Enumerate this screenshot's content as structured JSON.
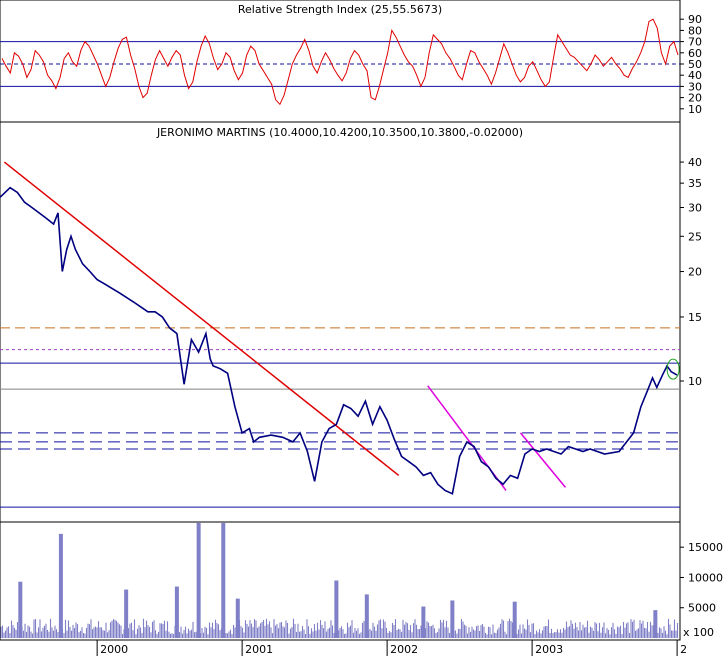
{
  "colors": {
    "price": "#000080",
    "rsi": "#e00000",
    "trend_red": "#e00000",
    "trend_magenta": "#e000e0",
    "volume": "#8080c8",
    "orange_level": "#c87020",
    "blue_level": "#1010a0",
    "violet_level": "#a040c0",
    "grid": "#000000"
  },
  "chart_data": [
    {
      "id": "rsi",
      "type": "line",
      "title": "Relative Strength Index (25,55.5673)",
      "ylim": [
        0,
        100
      ],
      "yticks": [
        10,
        20,
        30,
        40,
        50,
        60,
        70,
        80,
        90
      ],
      "levels": [
        70,
        50,
        30
      ],
      "x_start": 1999.33,
      "x_end": 2004.02,
      "series": [
        {
          "values": [
            55,
            48,
            42,
            60,
            57,
            50,
            38,
            45,
            62,
            58,
            52,
            40,
            35,
            28,
            38,
            55,
            60,
            52,
            48,
            62,
            70,
            66,
            58,
            50,
            40,
            30,
            38,
            52,
            64,
            72,
            74,
            58,
            46,
            30,
            20,
            24,
            40,
            54,
            62,
            55,
            48,
            56,
            62,
            58,
            40,
            28,
            34,
            52,
            66,
            75,
            68,
            55,
            45,
            50,
            60,
            56,
            44,
            36,
            42,
            58,
            66,
            62,
            50,
            44,
            38,
            32,
            18,
            14,
            22,
            36,
            50,
            58,
            64,
            72,
            62,
            48,
            42,
            52,
            60,
            54,
            46,
            40,
            35,
            42,
            55,
            62,
            58,
            50,
            44,
            20,
            18,
            30,
            45,
            60,
            80,
            74,
            66,
            58,
            52,
            48,
            40,
            30,
            38,
            60,
            76,
            72,
            68,
            60,
            55,
            48,
            40,
            36,
            50,
            62,
            60,
            52,
            46,
            40,
            32,
            42,
            55,
            68,
            60,
            50,
            40,
            34,
            38,
            48,
            52,
            44,
            36,
            30,
            34,
            56,
            76,
            70,
            64,
            58,
            56,
            52,
            48,
            44,
            50,
            58,
            54,
            48,
            52,
            56,
            50,
            46,
            40,
            38,
            46,
            52,
            60,
            70,
            88,
            90,
            82,
            60,
            50,
            66,
            70,
            58
          ]
        }
      ]
    },
    {
      "id": "price",
      "type": "line",
      "title": "JERONIMO MARTINS (10.4000,10.4200,10.3500,10.3800,-0.02000)",
      "scale": "log",
      "ylim": [
        4.2,
        46
      ],
      "yticks": [
        10,
        15,
        20,
        25,
        30,
        35,
        40
      ],
      "x_start": 1999.33,
      "x_end": 2004.02,
      "xticks": [
        "2000",
        "2001",
        "2002",
        "2003",
        "2"
      ],
      "xtick_positions": [
        2000,
        2001,
        2002,
        2003,
        2004
      ],
      "series": [
        {
          "x": [
            1999.33,
            1999.4,
            1999.45,
            1999.5,
            1999.55,
            1999.6,
            1999.65,
            1999.7,
            1999.73,
            1999.76,
            1999.79,
            1999.82,
            1999.85,
            1999.9,
            1999.95,
            2000.0,
            2000.05,
            2000.1,
            2000.15,
            2000.2,
            2000.25,
            2000.3,
            2000.35,
            2000.4,
            2000.45,
            2000.5,
            2000.55,
            2000.6,
            2000.65,
            2000.7,
            2000.75,
            2000.78,
            2000.8,
            2000.85,
            2000.9,
            2000.95,
            2001.0,
            2001.05,
            2001.08,
            2001.12,
            2001.2,
            2001.28,
            2001.35,
            2001.4,
            2001.45,
            2001.5,
            2001.55,
            2001.6,
            2001.65,
            2001.7,
            2001.75,
            2001.8,
            2001.85,
            2001.9,
            2001.95,
            2002.0,
            2002.05,
            2002.1,
            2002.15,
            2002.2,
            2002.25,
            2002.3,
            2002.35,
            2002.4,
            2002.45,
            2002.5,
            2002.55,
            2002.6,
            2002.65,
            2002.7,
            2002.75,
            2002.8,
            2002.85,
            2002.9,
            2002.95,
            2003.0,
            2003.05,
            2003.1,
            2003.15,
            2003.2,
            2003.25,
            2003.3,
            2003.35,
            2003.4,
            2003.5,
            2003.6,
            2003.7,
            2003.75,
            2003.8,
            2003.83,
            2003.86,
            2003.9,
            2003.93,
            2003.96,
            2004.0
          ],
          "y": [
            32,
            34,
            33,
            31,
            30,
            29,
            28,
            27,
            29,
            20,
            23,
            25,
            23,
            21,
            20,
            19,
            18.5,
            18,
            17.5,
            17,
            16.5,
            16,
            15.5,
            15.5,
            15,
            14,
            13.5,
            9.8,
            13,
            12,
            13.5,
            11.5,
            11,
            10.8,
            10.5,
            8.5,
            7.2,
            7.4,
            6.8,
            7.0,
            7.1,
            7.0,
            6.8,
            7.2,
            6.4,
            5.3,
            6.8,
            7.4,
            7.6,
            8.6,
            8.4,
            8.0,
            8.8,
            7.6,
            8.5,
            7.8,
            6.9,
            6.2,
            6.0,
            5.8,
            5.5,
            5.6,
            5.2,
            5.0,
            4.9,
            6.2,
            6.8,
            6.6,
            6.0,
            5.8,
            5.4,
            5.2,
            5.5,
            5.4,
            6.3,
            6.5,
            6.4,
            6.5,
            6.4,
            6.3,
            6.6,
            6.5,
            6.4,
            6.5,
            6.3,
            6.4,
            7.2,
            8.5,
            9.5,
            10.2,
            9.6,
            10.4,
            11.0,
            10.6,
            10.38
          ]
        }
      ],
      "horizontal_levels": [
        {
          "value": 14.0,
          "style": "orange-dashed"
        },
        {
          "value": 12.2,
          "style": "violet-dashed"
        },
        {
          "value": 11.2,
          "style": "blue-solid"
        },
        {
          "value": 9.5,
          "style": "grey-solid"
        },
        {
          "value": 7.2,
          "style": "blue-dashed"
        },
        {
          "value": 6.8,
          "style": "blue-dashed"
        },
        {
          "value": 6.5,
          "style": "blue-dashed"
        },
        {
          "value": 4.5,
          "style": "blue-solid"
        }
      ],
      "trendlines": [
        {
          "color": "red",
          "from": [
            1999.36,
            40
          ],
          "to": [
            2002.08,
            5.5
          ]
        },
        {
          "color": "magenta",
          "from": [
            2002.28,
            9.7
          ],
          "to": [
            2002.82,
            5.0
          ]
        },
        {
          "color": "magenta",
          "from": [
            2002.92,
            7.2
          ],
          "to": [
            2003.23,
            5.1
          ]
        }
      ]
    },
    {
      "id": "volume",
      "type": "bar",
      "ylim": [
        0,
        18500
      ],
      "yticks": [
        5000,
        10000,
        15000
      ],
      "x_unit_label": "x 100",
      "x_start": 1999.33,
      "x_end": 2004.02,
      "spikes": [
        {
          "x": 1999.47,
          "value": 9300
        },
        {
          "x": 1999.75,
          "value": 17200
        },
        {
          "x": 2000.2,
          "value": 8000
        },
        {
          "x": 2000.55,
          "value": 8500
        },
        {
          "x": 2000.7,
          "value": 19000
        },
        {
          "x": 2000.87,
          "value": 19000
        },
        {
          "x": 2000.97,
          "value": 6500
        },
        {
          "x": 2001.65,
          "value": 9500
        },
        {
          "x": 2001.86,
          "value": 7200
        },
        {
          "x": 2002.25,
          "value": 5200
        },
        {
          "x": 2002.45,
          "value": 6200
        },
        {
          "x": 2002.88,
          "value": 6000
        },
        {
          "x": 2003.85,
          "value": 4600
        }
      ]
    }
  ]
}
